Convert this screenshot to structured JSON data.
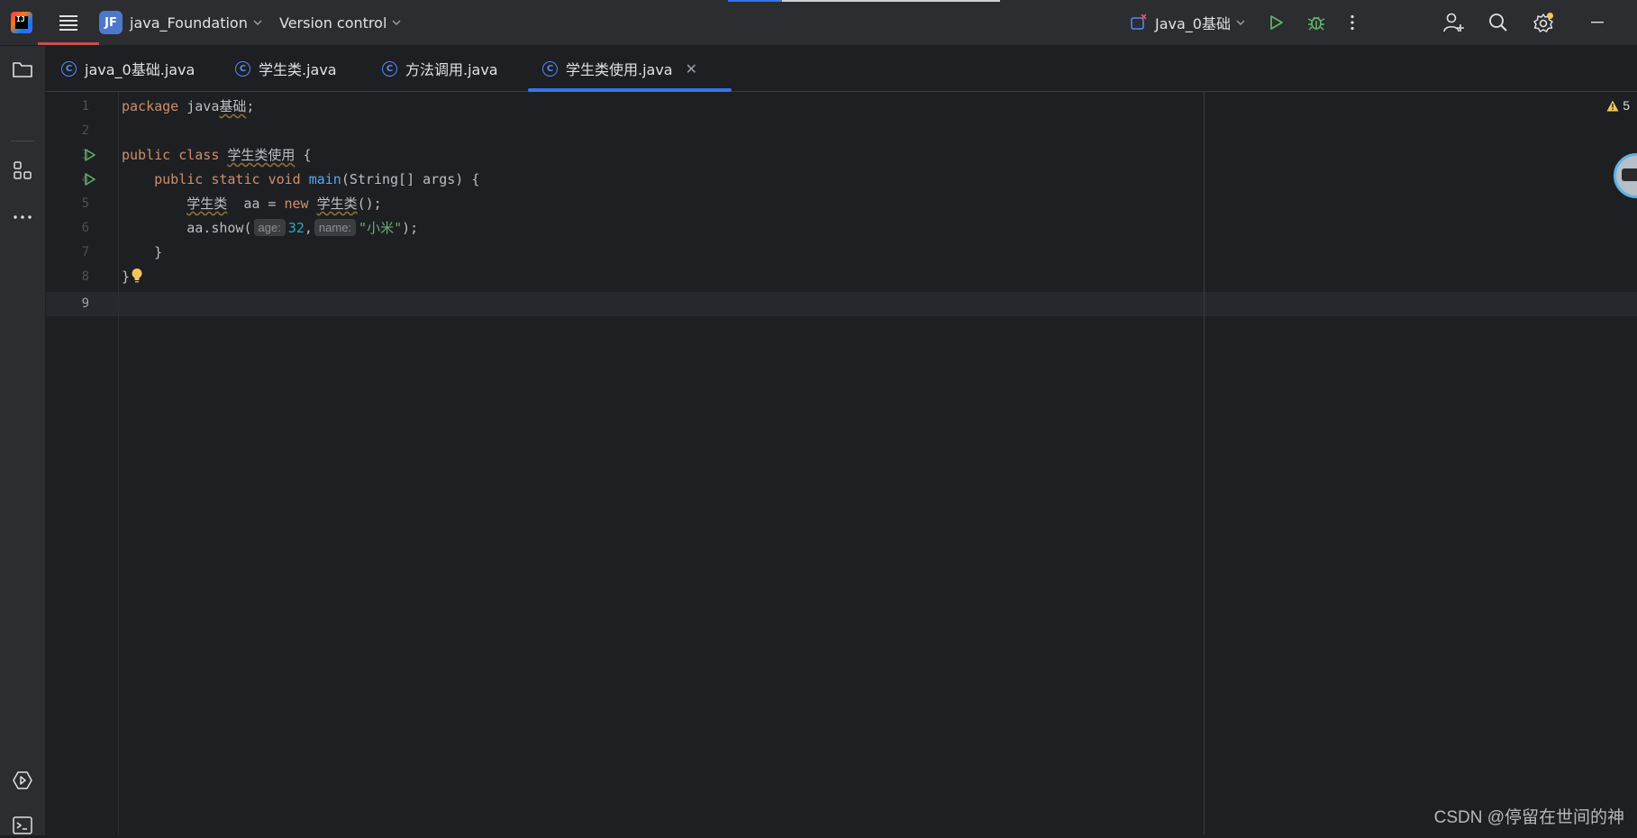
{
  "titlebar": {
    "project_badge": "JF",
    "project_name": "java_Foundation",
    "vcs_label": "Version control",
    "run_config": "Java_0基础"
  },
  "tabs": [
    {
      "label": "java_0基础.java",
      "icon": "class-icon"
    },
    {
      "label": "学生类.java",
      "icon": "class-icon"
    },
    {
      "label": "方法调用.java",
      "icon": "class-icon"
    },
    {
      "label": "学生类使用.java",
      "icon": "class-icon",
      "active": true
    }
  ],
  "editor": {
    "line_numbers": [
      "1",
      "2",
      "3",
      "4",
      "5",
      "6",
      "7",
      "8",
      "9"
    ],
    "current_line": "9",
    "warning_count": "5",
    "code": {
      "l1_kw": "package",
      "l1_rest_a": " java",
      "l1_pkg_warn": "基础",
      "l1_rest_b": ";",
      "l3_kw1": "public",
      "l3_kw2": "class",
      "l3_name": "学生类使用",
      "l3_brace": " {",
      "l4_indent": "    ",
      "l4_kw1": "public",
      "l4_kw2": "static",
      "l4_kw3": "void",
      "l4_fn": "main",
      "l4_rest": "(String[] args) {",
      "l5_indent": "        ",
      "l5_type": "学生类",
      "l5_mid": "  aa = ",
      "l5_kw": "new",
      "l5_ctor": "学生类",
      "l5_rest": "();",
      "l6_indent": "        ",
      "l6_call": "aa.show(",
      "l6_hint_age": "age:",
      "l6_num": "32",
      "l6_comma": ",",
      "l6_hint_name": "name:",
      "l6_str": "\"小米\"",
      "l6_end": ");",
      "l7": "    }",
      "l8": "}"
    }
  },
  "watermark": "CSDN @停留在世间的神",
  "colors": {
    "accent": "#3574f0",
    "run_green": "#5fb865",
    "keyword": "#cf8e6d",
    "function": "#56a8f5",
    "number": "#2aacb8",
    "string": "#6aab73",
    "warning": "#f2c55c"
  }
}
